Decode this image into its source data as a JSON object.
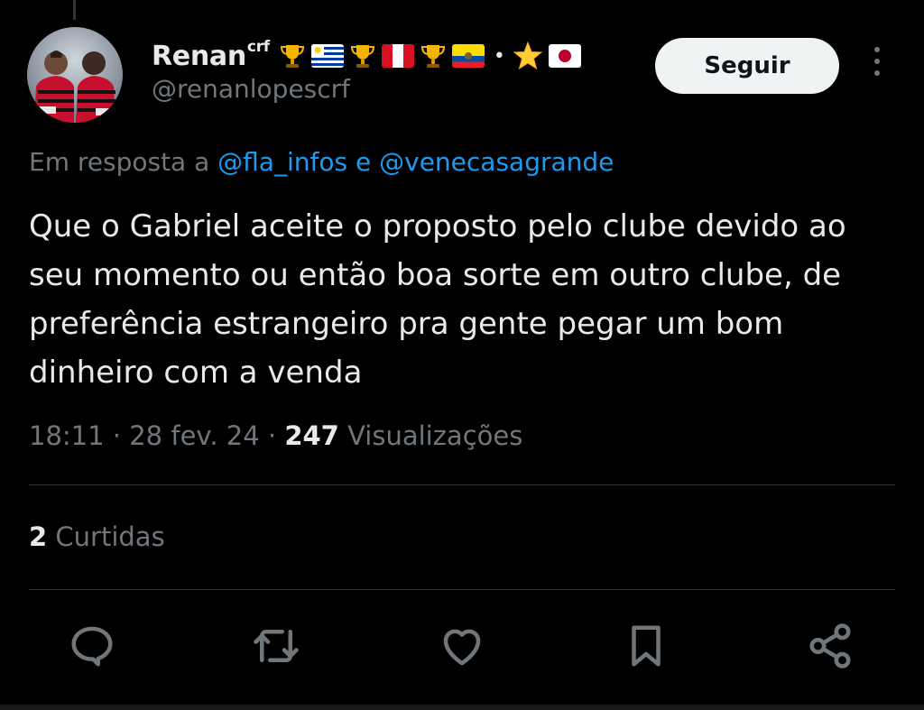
{
  "author": {
    "display_name": "Renan",
    "name_suffix": "crf",
    "handle": "@renanlopescrf",
    "badges": [
      "trophy-icon",
      "uruguay-flag-icon",
      "trophy-icon",
      "peru-flag-icon",
      "trophy-icon",
      "ecuador-flag-icon",
      "•",
      "star-icon",
      "japan-flag-icon"
    ]
  },
  "follow_button": {
    "label": "Seguir"
  },
  "reply_to": {
    "prefix": "Em resposta a",
    "mention1": "@fla_infos",
    "conjunction": "e",
    "mention2": "@venecasagrande"
  },
  "tweet": {
    "text": "Que o Gabriel aceite o proposto pelo clube devido ao seu momento ou então boa sorte em outro clube, de preferência estrangeiro pra gente pegar um bom dinheiro com a venda",
    "time": "18:11",
    "date": "28 fev. 24",
    "separator": "·",
    "views_count": "247",
    "views_label": "Visualizações"
  },
  "stats": {
    "likes_count": "2",
    "likes_label": "Curtidas"
  },
  "actions": [
    "reply-icon",
    "retweet-icon",
    "like-icon",
    "bookmark-icon",
    "share-icon"
  ],
  "colors": {
    "background": "#000000",
    "text": "#e7e9ea",
    "secondary": "#71767b",
    "link": "#1d9bf0",
    "button_bg": "#eff3f4",
    "divider": "#2f3336"
  }
}
